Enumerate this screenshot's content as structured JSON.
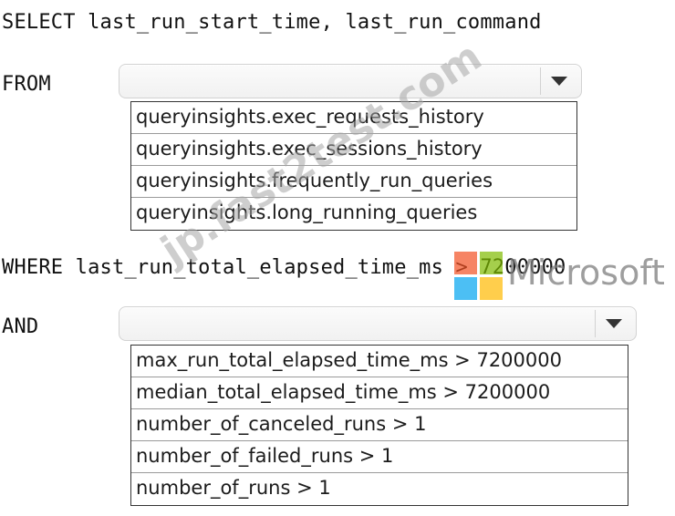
{
  "query": {
    "select_line": "SELECT last_run_start_time, last_run_command",
    "from_label": "FROM",
    "where_line": "WHERE last_run_total_elapsed_time_ms > 7200000",
    "and_label": "AND"
  },
  "dropdown_from": {
    "selected": "",
    "options": [
      "queryinsights.exec_requests_history",
      "queryinsights.exec_sessions_history",
      "queryinsights.frequently_run_queries",
      "queryinsights.long_running_queries"
    ]
  },
  "dropdown_and": {
    "selected": "",
    "options": [
      "max_run_total_elapsed_time_ms > 7200000",
      "median_total_elapsed_time_ms > 7200000",
      "number_of_canceled_runs > 1",
      "number_of_failed_runs > 1",
      "number_of_runs > 1"
    ]
  },
  "watermark": {
    "text": "jp.fast2test.com",
    "brand": "Microsoft",
    "colors": {
      "red": "#f25022",
      "green": "#7fba00",
      "blue": "#00a4ef",
      "yellow": "#ffb900"
    }
  },
  "icons": {
    "dropdown_arrow": "chevron-down-icon"
  }
}
